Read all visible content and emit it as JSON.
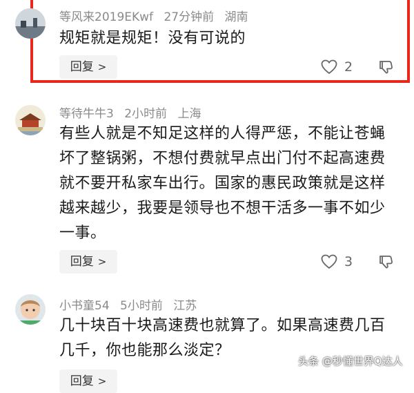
{
  "comments": [
    {
      "username": "等风来2019EKwf",
      "time": "27分钟前",
      "location": "湖南",
      "text": "规矩就是规矩！没有可说的",
      "reply_label": "回复",
      "likes": "2"
    },
    {
      "username": "等待牛牛3",
      "time": "2小时前",
      "location": "上海",
      "text": "有些人就是不知足这样的人得严惩，不能让苍蝇坏了整锅粥，不想付费就早点出门付不起高速费就不要开私家车出行。国家的惠民政策就是这样越来越少，我要是领导也不想干活多一事不如少一事。",
      "reply_label": "回复",
      "likes": "3"
    },
    {
      "username": "小书童54",
      "time": "5小时前",
      "location": "江苏",
      "text": "几十块百十块高速费也就算了。如果高速费几百几千，你也能那么淡定？",
      "reply_label": "回复",
      "likes": ""
    }
  ],
  "watermark": "头条 @秒懂世界Q达人",
  "colors": {
    "highlight": "#e8281c",
    "meta": "#8a8a8a",
    "reply_bg": "#f3f3f3"
  }
}
